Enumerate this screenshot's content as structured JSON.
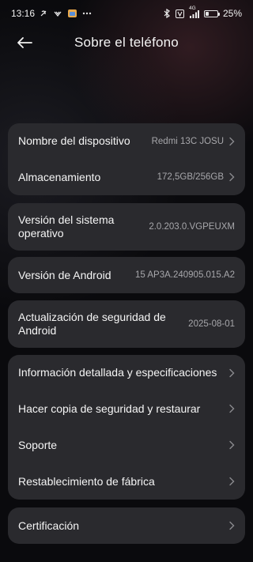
{
  "status_bar": {
    "time": "13:16",
    "network": "4G",
    "battery_text": "25%",
    "battery_level": 0.25,
    "left_icons": [
      "silent-mode-icon",
      "data-saver-icon",
      "app-notification-icon",
      "more-dots-icon"
    ],
    "right_icons": [
      "bluetooth-icon",
      "volte-icon",
      "signal-icon",
      "battery-icon"
    ]
  },
  "header": {
    "title": "Sobre el teléfono",
    "back_icon": "back-arrow-icon"
  },
  "cards": [
    {
      "rows": [
        {
          "label": "Nombre del dispositivo",
          "value": "Redmi 13C JOSU",
          "chevron": true
        },
        {
          "label": "Almacenamiento",
          "value": "172,5GB/256GB",
          "chevron": true
        }
      ]
    },
    {
      "rows": [
        {
          "label": "Versión del sistema operativo",
          "value": "2.0.203.0.VGPEUXM",
          "chevron": false
        }
      ]
    },
    {
      "rows": [
        {
          "label": "Versión de Android",
          "value": "15 AP3A.240905.015.A2",
          "chevron": false
        }
      ]
    },
    {
      "rows": [
        {
          "label": "Actualización de seguridad de Android",
          "value": "2025-08-01",
          "chevron": false
        }
      ]
    },
    {
      "rows": [
        {
          "label": "Información detallada y especificaciones",
          "value": "",
          "chevron": true
        },
        {
          "label": "Hacer copia de seguridad y restaurar",
          "value": "",
          "chevron": true
        },
        {
          "label": "Soporte",
          "value": "",
          "chevron": true
        },
        {
          "label": "Restablecimiento de fábrica",
          "value": "",
          "chevron": true
        }
      ]
    },
    {
      "rows": [
        {
          "label": "Certificación",
          "value": "",
          "chevron": true
        }
      ]
    }
  ],
  "colors": {
    "background": "#0a0a0d",
    "card": "#2a2a2e",
    "text_primary": "#f5f5f5",
    "text_secondary": "#a7a7ab"
  }
}
